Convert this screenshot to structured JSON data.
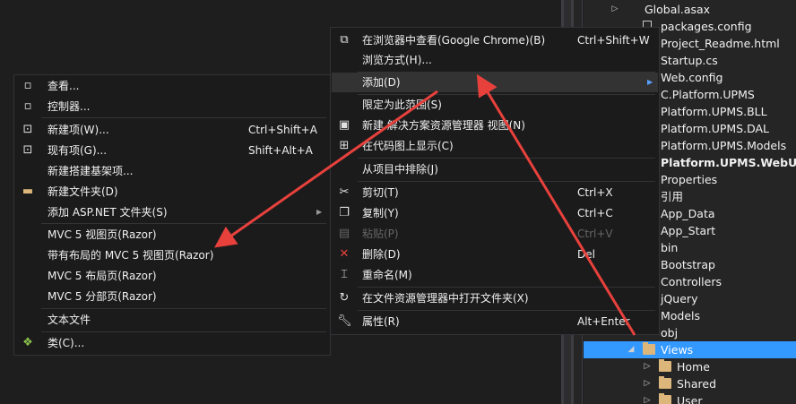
{
  "solution_explorer": {
    "items": [
      {
        "label": "Global.asax",
        "kind": "file",
        "expand": "▸"
      },
      {
        "label": "packages.config",
        "kind": "file"
      },
      {
        "label": "Project_Readme.html",
        "kind": "file"
      },
      {
        "label": "Startup.cs",
        "kind": "file"
      },
      {
        "label": "Web.config",
        "kind": "file"
      },
      {
        "label": "C.Platform.UPMS",
        "kind": "project"
      },
      {
        "label": "Platform.UPMS.BLL",
        "kind": "project"
      },
      {
        "label": "Platform.UPMS.DAL",
        "kind": "project"
      },
      {
        "label": "Platform.UPMS.Models",
        "kind": "project"
      },
      {
        "label": "Platform.UPMS.WebUI",
        "kind": "project"
      },
      {
        "label": "Properties",
        "kind": "folder"
      },
      {
        "label": "引用",
        "kind": "folder"
      },
      {
        "label": "App_Data",
        "kind": "folder"
      },
      {
        "label": "App_Start",
        "kind": "folder"
      },
      {
        "label": "bin",
        "kind": "folder"
      },
      {
        "label": "Bootstrap",
        "kind": "folder"
      },
      {
        "label": "Controllers",
        "kind": "folder"
      },
      {
        "label": "jQuery",
        "kind": "folder"
      },
      {
        "label": "Models",
        "kind": "folder"
      },
      {
        "label": "obj",
        "kind": "folder"
      },
      {
        "label": "Views",
        "kind": "folder"
      },
      {
        "label": "Home",
        "kind": "folder"
      },
      {
        "label": "Shared",
        "kind": "folder"
      },
      {
        "label": "User",
        "kind": "folder"
      }
    ],
    "selected_label": "Views",
    "bold_label": "Platform.UPMS.WebUI",
    "selection_color": "#3399ff"
  },
  "context_menu": {
    "items": [
      {
        "label": "在浏览器中查看(Google Chrome)(B)",
        "shortcut": "Ctrl+Shift+W",
        "icon": "browser-icon"
      },
      {
        "label": "浏览方式(H)...",
        "shortcut": ""
      },
      {
        "label": "添加(D)",
        "shortcut": "",
        "submenu": true
      },
      {
        "label": "限定为此范围(S)",
        "shortcut": ""
      },
      {
        "label": "新建 解决方案资源管理器 视图(N)",
        "shortcut": "",
        "icon": "new-view-icon"
      },
      {
        "label": "在代码图上显示(C)",
        "shortcut": "",
        "icon": "code-map-icon"
      },
      {
        "label": "从项目中排除(J)",
        "shortcut": ""
      },
      {
        "label": "剪切(T)",
        "shortcut": "Ctrl+X",
        "icon": "cut-icon"
      },
      {
        "label": "复制(Y)",
        "shortcut": "Ctrl+C",
        "icon": "copy-icon"
      },
      {
        "label": "粘贴(P)",
        "shortcut": "Ctrl+V",
        "icon": "paste-icon",
        "disabled": true
      },
      {
        "label": "删除(D)",
        "shortcut": "Del",
        "icon": "delete-icon"
      },
      {
        "label": "重命名(M)",
        "shortcut": "",
        "icon": "rename-icon"
      },
      {
        "label": "在文件资源管理器中打开文件夹(X)",
        "shortcut": "",
        "icon": "open-folder-icon"
      },
      {
        "label": "属性(R)",
        "shortcut": "Alt+Enter",
        "icon": "properties-icon"
      }
    ]
  },
  "add_submenu": {
    "items": [
      {
        "label": "查看...",
        "shortcut": "",
        "icon": "view-icon"
      },
      {
        "label": "控制器...",
        "shortcut": "",
        "icon": "controller-icon"
      },
      {
        "label": "新建项(W)...",
        "shortcut": "Ctrl+Shift+A",
        "icon": "new-item-icon"
      },
      {
        "label": "现有项(G)...",
        "shortcut": "Shift+Alt+A",
        "icon": "existing-item-icon"
      },
      {
        "label": "新建搭建基架项...",
        "shortcut": ""
      },
      {
        "label": "新建文件夹(D)",
        "shortcut": "",
        "icon": "new-folder-icon"
      },
      {
        "label": "添加 ASP.NET 文件夹(S)",
        "shortcut": "",
        "submenu": true
      },
      {
        "label": "MVC 5 视图页(Razor)",
        "shortcut": ""
      },
      {
        "label": "带有布局的 MVC 5 视图页(Razor)",
        "shortcut": ""
      },
      {
        "label": "MVC 5 布局页(Razor)",
        "shortcut": ""
      },
      {
        "label": "MVC 5 分部页(Razor)",
        "shortcut": ""
      },
      {
        "label": "文本文件",
        "shortcut": ""
      },
      {
        "label": "类(C)...",
        "shortcut": "",
        "icon": "class-icon"
      }
    ]
  },
  "annotation_color": "#e8413c"
}
